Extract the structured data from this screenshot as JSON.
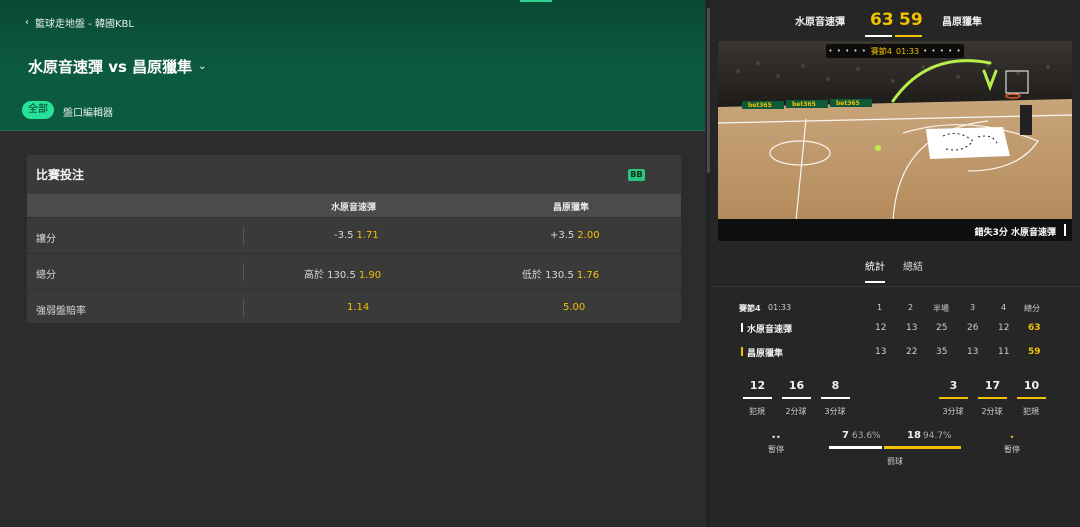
{
  "colors": {
    "accent": "#27e29b",
    "odds": "#f2c200",
    "hero": "#0b5a3f",
    "bg": "#2c2c2c",
    "panel": "#262626"
  },
  "breadcrumb": {
    "icon": "chevron-left-icon",
    "text": "籃球走地盤 - 韓國KBL"
  },
  "match": {
    "title": "水原音速彈 vs 昌原獵隼",
    "dropdown_icon": "chevron-down-icon"
  },
  "filters": {
    "all": "全部",
    "editor": "盤口編輯器"
  },
  "market": {
    "title": "比賽投注",
    "badge": "BB",
    "col_home": "水原音速彈",
    "col_away": "昌原獵隼",
    "rows": [
      {
        "label": "讓分",
        "home_line": "-3.5",
        "home_odds": "1.71",
        "away_line": "+3.5",
        "away_odds": "2.00"
      },
      {
        "label": "總分",
        "home_line": "高於 130.5",
        "home_odds": "1.90",
        "away_line": "低於 130.5",
        "away_odds": "1.76"
      },
      {
        "label": "強弱盤賠率",
        "home_line": "",
        "home_odds": "1.14",
        "away_line": "",
        "away_odds": "5.00"
      }
    ]
  },
  "scoreboard": {
    "home_name": "水原音速彈",
    "away_name": "昌原獵隼",
    "home_score": "63",
    "away_score": "59"
  },
  "court": {
    "period": "賽節4",
    "clock": "01:33",
    "sponsor": "bet365",
    "event": "錯失3分 水原音速彈"
  },
  "stat_tabs": {
    "stats": "統計",
    "summary": "總結"
  },
  "quarters": {
    "period_label": "賽節4",
    "time": "01:33",
    "headers": [
      "1",
      "2",
      "半場",
      "3",
      "4",
      "總分"
    ],
    "home": {
      "name": "水原音速彈",
      "scores": [
        "12",
        "13",
        "25",
        "26",
        "12",
        "63"
      ]
    },
    "away": {
      "name": "昌原獵隼",
      "scores": [
        "13",
        "22",
        "35",
        "13",
        "11",
        "59"
      ]
    }
  },
  "team_stats": {
    "home": [
      {
        "value": "12",
        "label": "犯規"
      },
      {
        "value": "16",
        "label": "2分球"
      },
      {
        "value": "8",
        "label": "3分球"
      }
    ],
    "away": [
      {
        "value": "3",
        "label": "3分球"
      },
      {
        "value": "17",
        "label": "2分球"
      },
      {
        "value": "10",
        "label": "犯規"
      }
    ],
    "home_timeouts": "••",
    "away_timeouts": "•",
    "timeout_label": "暫停",
    "ft_home_made": "7",
    "ft_home_pct": "63.6%",
    "ft_away_made": "18",
    "ft_away_pct": "94.7%",
    "ft_label": "罰球",
    "ft_home_fraction": 0.402,
    "ft_away_fraction": 0.598
  }
}
